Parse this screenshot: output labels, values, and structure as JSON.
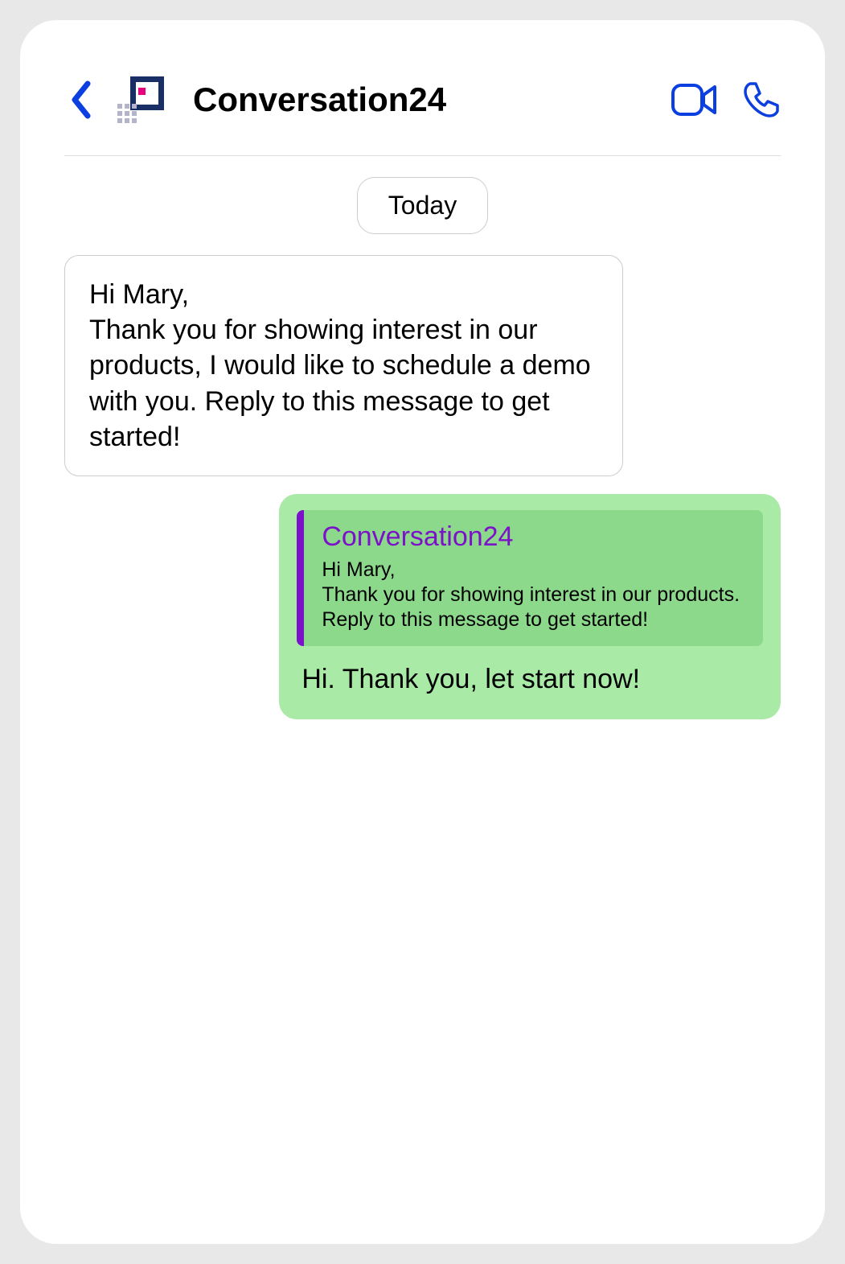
{
  "header": {
    "title": "Conversation24"
  },
  "date_label": "Today",
  "messages": {
    "incoming": "Hi Mary,\nThank you for showing interest in our products, I would like to schedule a demo with you. Reply to this message to get started!",
    "outgoing": {
      "quote": {
        "sender": "Conversation24",
        "body": "Hi Mary,\nThank you for showing interest in our products. Reply to this message to get started!"
      },
      "reply": "Hi. Thank you, let start now!"
    }
  },
  "colors": {
    "accent_blue": "#0b3fe0",
    "bubble_out": "#a8eaa6",
    "quote_border": "#7b11c9"
  }
}
